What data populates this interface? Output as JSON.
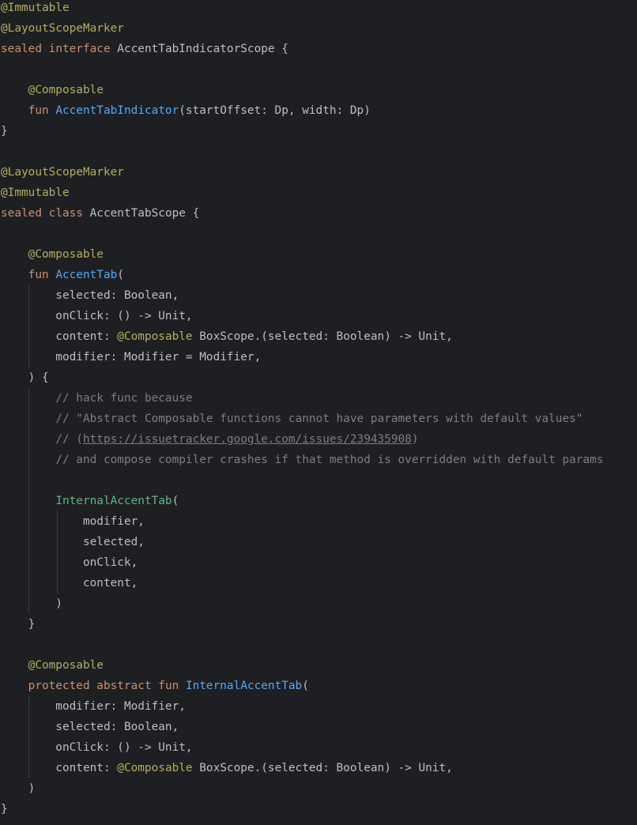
{
  "editor": {
    "colors": {
      "background": "#1e1f22",
      "text": "#bcbec4",
      "annotation": "#b3ae60",
      "keyword": "#cf8e6d",
      "function_declaration": "#56a8f5",
      "function_call": "#5fb386",
      "comment": "#7a7e85",
      "indent_guide": "#393b40"
    },
    "lines": [
      [
        {
          "c": "annot",
          "t": "@Immutable"
        }
      ],
      [
        {
          "c": "annot",
          "t": "@LayoutScopeMarker"
        }
      ],
      [
        {
          "c": "kw",
          "t": "sealed "
        },
        {
          "c": "kw",
          "t": "interface "
        },
        {
          "c": "plain",
          "t": "AccentTabIndicatorScope {"
        }
      ],
      [],
      [
        {
          "c": "plain",
          "t": "    "
        },
        {
          "c": "annot",
          "t": "@Composable"
        }
      ],
      [
        {
          "c": "plain",
          "t": "    "
        },
        {
          "c": "kw",
          "t": "fun "
        },
        {
          "c": "fn",
          "t": "AccentTabIndicator"
        },
        {
          "c": "plain",
          "t": "(startOffset: Dp, width: Dp)"
        }
      ],
      [
        {
          "c": "plain",
          "t": "}"
        }
      ],
      [],
      [
        {
          "c": "annot",
          "t": "@LayoutScopeMarker"
        }
      ],
      [
        {
          "c": "annot",
          "t": "@Immutable"
        }
      ],
      [
        {
          "c": "kw",
          "t": "sealed "
        },
        {
          "c": "kw",
          "t": "class "
        },
        {
          "c": "plain",
          "t": "AccentTabScope {"
        }
      ],
      [],
      [
        {
          "c": "plain",
          "t": "    "
        },
        {
          "c": "annot",
          "t": "@Composable"
        }
      ],
      [
        {
          "c": "plain",
          "t": "    "
        },
        {
          "c": "kw",
          "t": "fun "
        },
        {
          "c": "fn",
          "t": "AccentTab"
        },
        {
          "c": "plain",
          "t": "("
        }
      ],
      [
        {
          "c": "plain",
          "t": "        selected: Boolean,"
        }
      ],
      [
        {
          "c": "plain",
          "t": "        onClick: () -> Unit,"
        }
      ],
      [
        {
          "c": "plain",
          "t": "        content: "
        },
        {
          "c": "annot",
          "t": "@Composable "
        },
        {
          "c": "plain",
          "t": "BoxScope.(selected: Boolean) -> Unit,"
        }
      ],
      [
        {
          "c": "plain",
          "t": "        modifier: Modifier = Modifier,"
        }
      ],
      [
        {
          "c": "plain",
          "t": "    ) {"
        }
      ],
      [
        {
          "c": "plain",
          "t": "        "
        },
        {
          "c": "comment",
          "t": "// hack func because"
        }
      ],
      [
        {
          "c": "plain",
          "t": "        "
        },
        {
          "c": "comment",
          "t": "// \"Abstract Composable functions cannot have parameters with default values\""
        }
      ],
      [
        {
          "c": "plain",
          "t": "        "
        },
        {
          "c": "comment",
          "t": "// ("
        },
        {
          "c": "link",
          "t": "https://issuetracker.google.com/issues/239435908"
        },
        {
          "c": "comment",
          "t": ")"
        }
      ],
      [
        {
          "c": "plain",
          "t": "        "
        },
        {
          "c": "comment",
          "t": "// and compose compiler crashes if that method is overridden with default params"
        }
      ],
      [],
      [
        {
          "c": "plain",
          "t": "        "
        },
        {
          "c": "call",
          "t": "InternalAccentTab"
        },
        {
          "c": "plain",
          "t": "("
        }
      ],
      [
        {
          "c": "plain",
          "t": "            modifier,"
        }
      ],
      [
        {
          "c": "plain",
          "t": "            selected,"
        }
      ],
      [
        {
          "c": "plain",
          "t": "            onClick,"
        }
      ],
      [
        {
          "c": "plain",
          "t": "            content,"
        }
      ],
      [
        {
          "c": "plain",
          "t": "        )"
        }
      ],
      [
        {
          "c": "plain",
          "t": "    }"
        }
      ],
      [],
      [
        {
          "c": "plain",
          "t": "    "
        },
        {
          "c": "annot",
          "t": "@Composable"
        }
      ],
      [
        {
          "c": "plain",
          "t": "    "
        },
        {
          "c": "kw",
          "t": "protected "
        },
        {
          "c": "kw",
          "t": "abstract "
        },
        {
          "c": "kw",
          "t": "fun "
        },
        {
          "c": "fn",
          "t": "InternalAccentTab"
        },
        {
          "c": "plain",
          "t": "("
        }
      ],
      [
        {
          "c": "plain",
          "t": "        modifier: Modifier,"
        }
      ],
      [
        {
          "c": "plain",
          "t": "        selected: Boolean,"
        }
      ],
      [
        {
          "c": "plain",
          "t": "        onClick: () -> Unit,"
        }
      ],
      [
        {
          "c": "plain",
          "t": "        content: "
        },
        {
          "c": "annot",
          "t": "@Composable "
        },
        {
          "c": "plain",
          "t": "BoxScope.(selected: Boolean) -> Unit,"
        }
      ],
      [
        {
          "c": "plain",
          "t": "    )"
        }
      ],
      [
        {
          "c": "plain",
          "t": "}"
        }
      ]
    ]
  }
}
